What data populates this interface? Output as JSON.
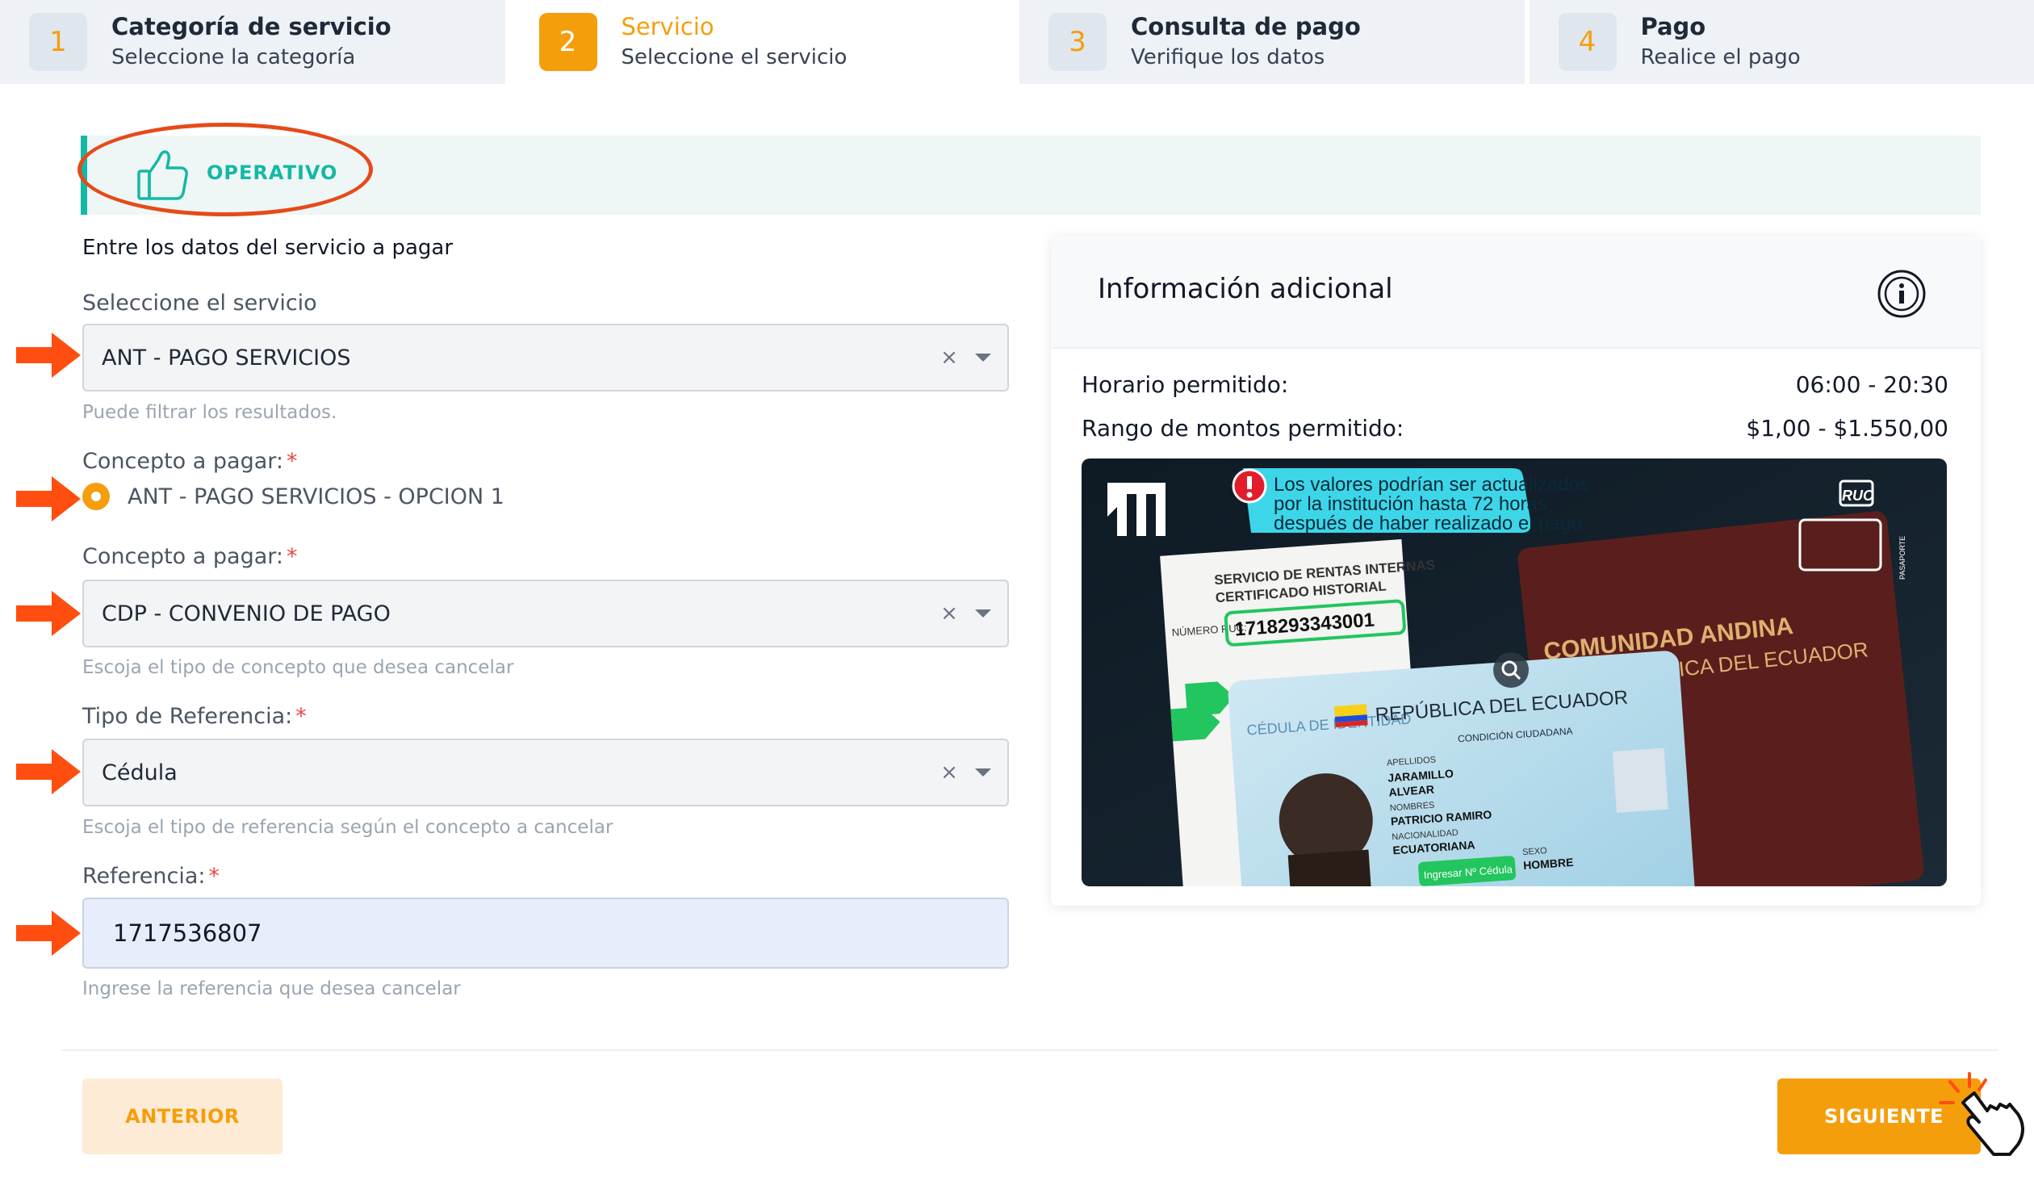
{
  "stepper": [
    {
      "num": "1",
      "title": "Categoría de servicio",
      "subtitle": "Seleccione la categoría",
      "active": false
    },
    {
      "num": "2",
      "title": "Servicio",
      "subtitle": "Seleccione el servicio",
      "active": true
    },
    {
      "num": "3",
      "title": "Consulta de pago",
      "subtitle": "Verifique los datos",
      "active": false
    },
    {
      "num": "4",
      "title": "Pago",
      "subtitle": "Realice el pago",
      "active": false
    }
  ],
  "status": {
    "label": "OPERATIVO",
    "icon": "thumbs-up-icon",
    "color": "#14b8a6"
  },
  "form": {
    "title": "Entre los datos del servicio a pagar",
    "service": {
      "label": "Seleccione el servicio",
      "value": "ANT - PAGO SERVICIOS",
      "hint": "Puede filtrar los resultados."
    },
    "concept_radio": {
      "label": "Concepto a pagar:",
      "required": "*",
      "option": "ANT - PAGO SERVICIOS - OPCION 1"
    },
    "concept_select": {
      "label": "Concepto a pagar:",
      "required": "*",
      "value": "CDP - CONVENIO DE PAGO",
      "hint": "Escoja el tipo de concepto que desea cancelar"
    },
    "ref_type": {
      "label": "Tipo de Referencia:",
      "required": "*",
      "value": "Cédula",
      "hint": "Escoja el tipo de referencia según el concepto a cancelar"
    },
    "reference": {
      "label": "Referencia:",
      "required": "*",
      "value": "1717536807",
      "hint": "Ingrese la referencia que desea cancelar"
    },
    "clear_symbol": "×"
  },
  "info": {
    "title": "Información adicional",
    "hours_label": "Horario permitido:",
    "hours_value": "06:00 - 20:30",
    "range_label": "Rango de montos permitido:",
    "range_value": "$1,00 - $1.550,00",
    "banner": {
      "notice_line1": "Los valores podrían ser actualizados",
      "notice_line2": "por la institución hasta 72 horas",
      "notice_line3": "después de haber realizado el pago.",
      "ruc": "RUC",
      "ruc_number": "1718293343001",
      "cert_line1": "SERVICIO DE RENTAS INTERNAS",
      "cert_line2": "CERTIFICADO HISTORIAL",
      "ruc_label": "NÚMERO RUC:",
      "comunidad": "COMUNIDAD ANDINA",
      "republica": "REPÚBLICA DEL ECUADOR",
      "cedula_title": "REPÚBLICA DEL ECUADOR",
      "cedula_label": "CÉDULA DE IDENTIDAD",
      "condicion": "CONDICIÓN CIUDADANA",
      "apellidos": "APELLIDOS",
      "apellido1": "JARAMILLO",
      "apellido2": "ALVEAR",
      "nombres_label": "NOMBRES",
      "nombres": "PATRICIO RAMIRO",
      "nacionalidad_label": "NACIONALIDAD",
      "nacionalidad": "ECUATORIANA",
      "sexo_label": "SEXO",
      "sexo": "HOMBRE",
      "ingresar": "Ingresar Nº Cédula",
      "pasaporte": "PASAPORTE"
    }
  },
  "buttons": {
    "prev": "ANTERIOR",
    "next": "SIGUIENTE"
  },
  "colors": {
    "accent": "#f59e0b",
    "annotation": "#ff4e0f",
    "status": "#14b8a6",
    "required": "#ef4444"
  }
}
